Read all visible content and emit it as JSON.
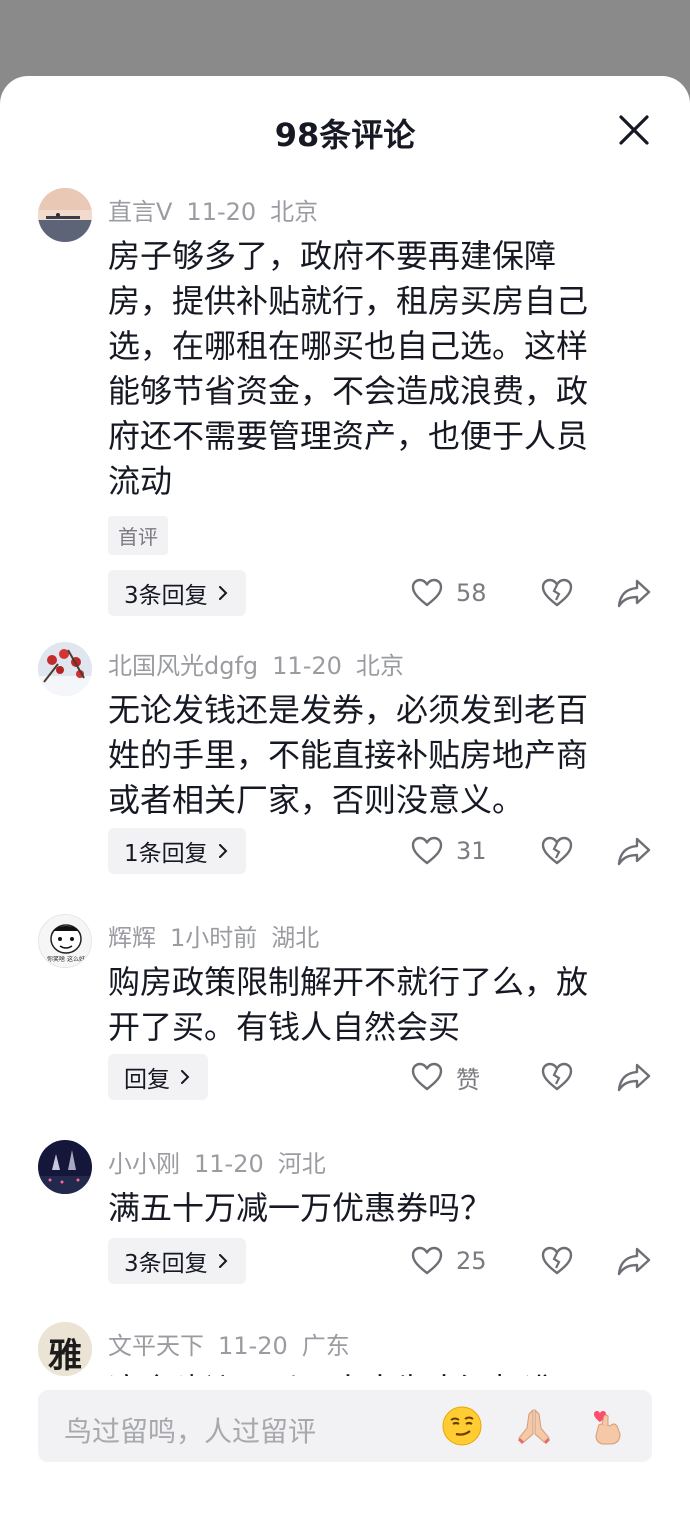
{
  "header": {
    "title": "98条评论"
  },
  "comments": [
    {
      "user": "直言V",
      "date": "11-20",
      "location": "北京",
      "lines": [
        "房子够多了，政府不要再建保障",
        "房，提供补贴就行，租房买房自己",
        "选，在哪租在哪买也自己选。这样",
        "能够节省资金，不会造成浪费，政",
        "府还不需要管理资产，也便于人员",
        "流动"
      ],
      "tag": "首评",
      "reply_label": "3条回复",
      "likes": "58"
    },
    {
      "user": "北国风光dgfg",
      "date": "11-20",
      "location": "北京",
      "lines": [
        "无论发钱还是发券，必须发到老百",
        "姓的手里，不能直接补贴房地产商",
        "或者相关厂家，否则没意义。"
      ],
      "reply_label": "1条回复",
      "likes": "31"
    },
    {
      "user": "辉辉",
      "date": "1小时前",
      "location": "湖北",
      "lines": [
        "购房政策限制解开不就行了么，放",
        "开了买。有钱人自然会买"
      ],
      "reply_label": "回复",
      "likes": "赞",
      "avatar_caption": "你笑啥 这么好"
    },
    {
      "user": "小小刚",
      "date": "11-20",
      "location": "河北",
      "lines": [
        "满五十万减一万优惠券吗？"
      ],
      "reply_label": "3条回复",
      "likes": "25"
    },
    {
      "user": "文平天下",
      "date": "11-20",
      "location": "广东",
      "lines": [
        "这个建议，以工人出为大河标准"
      ],
      "avatar_text": "雅"
    }
  ],
  "input": {
    "placeholder": "鸟过留鸣，人过留评"
  },
  "emojis": [
    "smirk-face",
    "praying-hands",
    "finger-heart"
  ]
}
